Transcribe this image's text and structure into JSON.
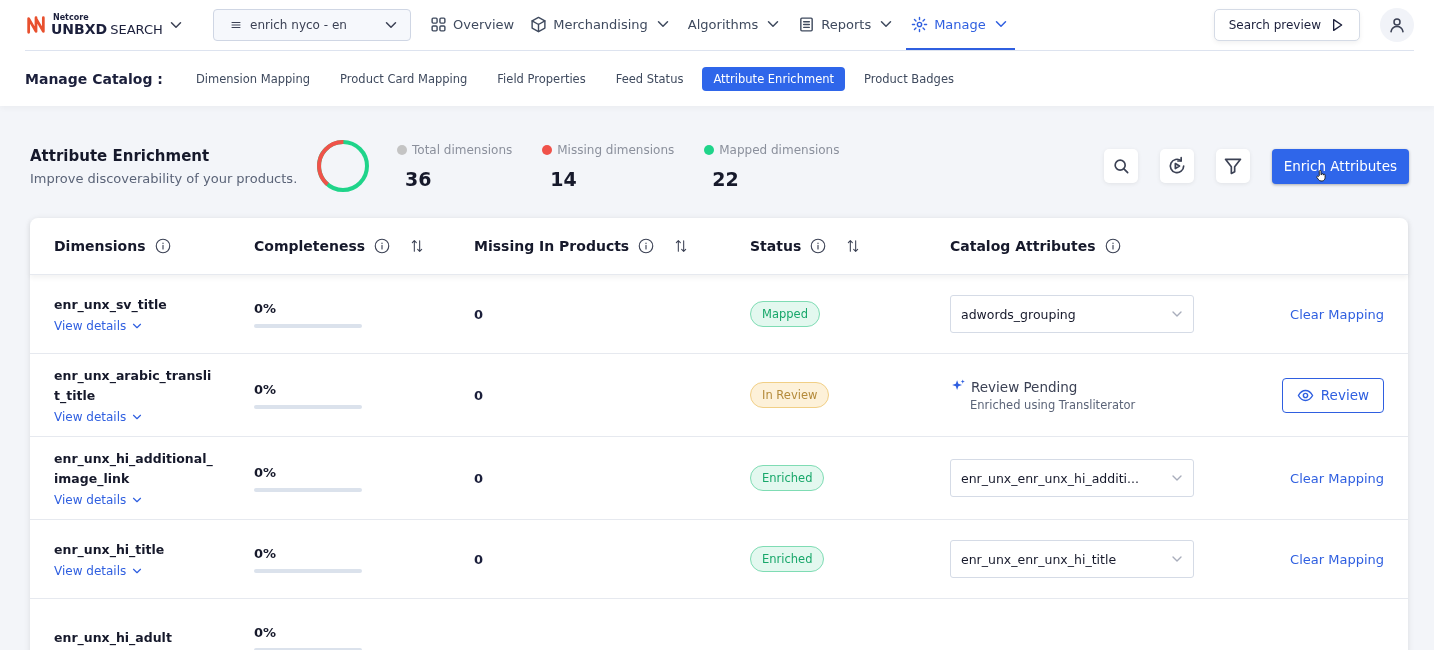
{
  "brand": {
    "company": "Netcore",
    "product": "UNBXD",
    "suffix": "SEARCH"
  },
  "site_selector": {
    "value": "enrich nyco - en"
  },
  "nav": [
    {
      "label": "Overview",
      "dropdown": false,
      "selected": false
    },
    {
      "label": "Merchandising",
      "dropdown": true,
      "selected": false
    },
    {
      "label": "Algorithms",
      "dropdown": true,
      "selected": false
    },
    {
      "label": "Reports",
      "dropdown": true,
      "selected": false
    },
    {
      "label": "Manage",
      "dropdown": true,
      "selected": true
    }
  ],
  "search_preview": {
    "label": "Search preview"
  },
  "subnav": {
    "title": "Manage Catalog :",
    "tabs": [
      {
        "label": "Dimension Mapping",
        "selected": false
      },
      {
        "label": "Product Card Mapping",
        "selected": false
      },
      {
        "label": "Field Properties",
        "selected": false
      },
      {
        "label": "Feed Status",
        "selected": false
      },
      {
        "label": "Attribute Enrichment",
        "selected": true
      },
      {
        "label": "Product Badges",
        "selected": false
      }
    ]
  },
  "summary": {
    "title": "Attribute Enrichment",
    "subtitle": "Improve discoverability of your products.",
    "stats": [
      {
        "label": "Total dimensions",
        "value": "36",
        "color": "#c4c4c4"
      },
      {
        "label": "Missing dimensions",
        "value": "14",
        "color": "#f0524a"
      },
      {
        "label": "Mapped dimensions",
        "value": "22",
        "color": "#1fd48a"
      }
    ],
    "enrich_button": "Enrich Attributes"
  },
  "table": {
    "columns": [
      {
        "label": "Dimensions",
        "sortable": false
      },
      {
        "label": "Completeness",
        "sortable": true
      },
      {
        "label": "Missing In Products",
        "sortable": true
      },
      {
        "label": "Status",
        "sortable": true
      },
      {
        "label": "Catalog Attributes",
        "sortable": false
      }
    ],
    "rows": [
      {
        "name": "enr_unx_sv_title",
        "details": "View details",
        "completeness": "0%",
        "level": 0,
        "missing": "0",
        "status": {
          "label": "Mapped",
          "kind": "mapped"
        },
        "attribute": {
          "kind": "select",
          "value": "adwords_grouping"
        },
        "action": {
          "kind": "link",
          "label": "Clear Mapping"
        }
      },
      {
        "name": "enr_unx_arabic_translit_title",
        "details": "View details",
        "completeness": "0%",
        "level": 0,
        "missing": "0",
        "status": {
          "label": "In Review",
          "kind": "review"
        },
        "attribute": {
          "kind": "pending",
          "title": "Review Pending",
          "note": "Enriched using Transliterator"
        },
        "action": {
          "kind": "button",
          "label": "Review"
        }
      },
      {
        "name": "enr_unx_hi_additional_image_link",
        "details": "View details",
        "completeness": "0%",
        "level": 0,
        "missing": "0",
        "status": {
          "label": "Enriched",
          "kind": "enriched"
        },
        "attribute": {
          "kind": "select",
          "value": "enr_unx_enr_unx_hi_additi..."
        },
        "action": {
          "kind": "link",
          "label": "Clear Mapping"
        }
      },
      {
        "name": "enr_unx_hi_title",
        "details": "View details",
        "completeness": "0%",
        "level": 0,
        "missing": "0",
        "status": {
          "label": "Enriched",
          "kind": "enriched"
        },
        "attribute": {
          "kind": "select",
          "value": "enr_unx_enr_unx_hi_title"
        },
        "action": {
          "kind": "link",
          "label": "Clear Mapping"
        }
      },
      {
        "name": "enr_unx_hi_adult",
        "completeness": "0%",
        "level": 0
      }
    ]
  }
}
